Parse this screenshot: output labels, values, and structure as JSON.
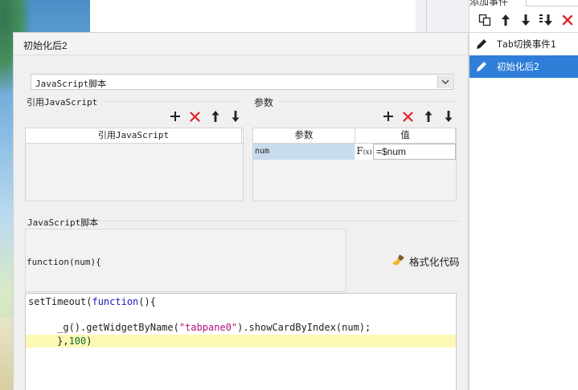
{
  "right_panel": {
    "title": "添加事件",
    "events": [
      {
        "label": "Tab切换事件1",
        "selected": false
      },
      {
        "label": "初始化后2",
        "selected": true
      }
    ]
  },
  "dialog": {
    "title": "初始化后2",
    "script_type": "JavaScript脚本",
    "referenced_js": {
      "section_label": "引用JavaScript",
      "column_header": "引用JavaScript"
    },
    "params": {
      "section_label": "参数",
      "columns": [
        "参数",
        "值"
      ],
      "rows": [
        {
          "name": "num",
          "value": "=$num"
        }
      ],
      "formula_symbol": "F",
      "formula_sub": "(x)"
    },
    "script": {
      "section_label": "JavaScript脚本",
      "function_signature": "function(num){",
      "format_label": "格式化代码",
      "code_lines": [
        {
          "parts": [
            {
              "t": "setTimeout(",
              "c": ""
            },
            {
              "t": "function",
              "c": "kw"
            },
            {
              "t": "(){",
              "c": ""
            }
          ],
          "highlight": false
        },
        {
          "parts": [],
          "highlight": false
        },
        {
          "parts": [
            {
              "t": "     _g().getWidgetByName(",
              "c": ""
            },
            {
              "t": "\"tabpane0\"",
              "c": "str"
            },
            {
              "t": ").showCardByIndex(num);",
              "c": ""
            }
          ],
          "highlight": false
        },
        {
          "parts": [
            {
              "t": "     },",
              "c": ""
            },
            {
              "t": "100",
              "c": "num"
            },
            {
              "t": ")",
              "c": ""
            }
          ],
          "highlight": true
        }
      ]
    }
  },
  "colors": {
    "selected_bg": "#2f7ed8",
    "delete_red": "#e0262b",
    "highlight_line": "#fdf9b4",
    "param_cell_bg": "#c8dced"
  },
  "icons": {
    "toolbar": [
      "copy-icon",
      "arrow-up-icon",
      "arrow-down-icon",
      "move-bottom-icon",
      "delete-icon"
    ],
    "mini_toolbar": [
      "add-icon",
      "delete-icon",
      "arrow-up-icon",
      "arrow-down-icon"
    ],
    "event_item": "edit-pencil-icon",
    "format": "brush-icon"
  }
}
